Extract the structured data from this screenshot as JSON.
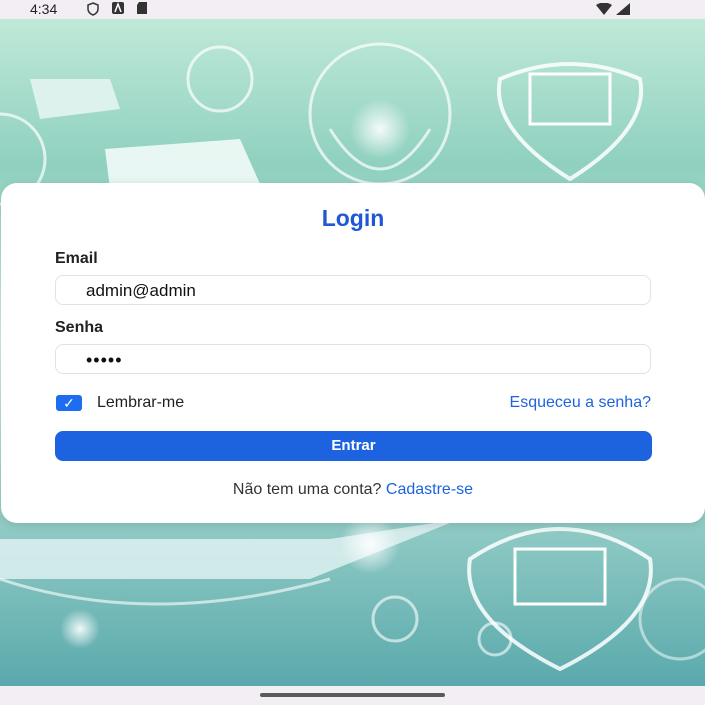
{
  "statusbar": {
    "time": "4:34"
  },
  "login": {
    "title": "Login",
    "email_label": "Email",
    "email_value": "admin@admin",
    "password_label": "Senha",
    "password_value": "•••••",
    "remember_label": "Lembrar-me",
    "remember_checked": true,
    "forgot_link": "Esqueceu a senha?",
    "submit_label": "Entrar",
    "signup_prompt": "Não tem uma conta?",
    "signup_link": "Cadastre-se"
  },
  "colors": {
    "accent": "#1d63e0",
    "title": "#1f57d6"
  }
}
